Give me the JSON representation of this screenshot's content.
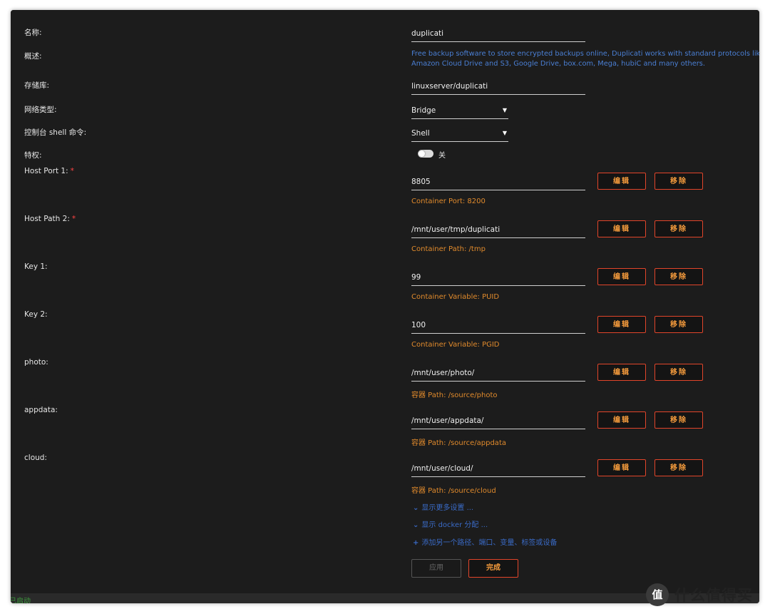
{
  "form": {
    "name_label": "名称:",
    "name_value": "duplicati",
    "overview_label": "概述:",
    "overview_line1": "Free backup software to store encrypted backups online, Duplicati works with standard protocols like FTP, SSH, WebDAV as well as popular services like Microsoft OneDrive,",
    "overview_line2": "Amazon Cloud Drive and S3, Google Drive, box.com, Mega, hubiC and many others.",
    "repo_label": "存储库:",
    "repo_value": "linuxserver/duplicati",
    "network_label": "网络类型:",
    "network_value": "Bridge",
    "shell_label": "控制台 shell 命令:",
    "shell_value": "Shell",
    "privileged_label": "特权:",
    "privileged_state": "关"
  },
  "entries": [
    {
      "label": "Host Port 1:",
      "required": "*",
      "value": "8805",
      "hint": "Container Port: 8200"
    },
    {
      "label": "Host Path 2:",
      "required": "*",
      "value": "/mnt/user/tmp/duplicati",
      "hint": "Container Path: /tmp"
    },
    {
      "label": "Key 1:",
      "required": "",
      "value": "99",
      "hint": "Container Variable: PUID"
    },
    {
      "label": "Key 2:",
      "required": "",
      "value": "100",
      "hint": "Container Variable: PGID"
    },
    {
      "label": "photo:",
      "required": "",
      "value": "/mnt/user/photo/",
      "hint": "容器 Path: /source/photo"
    },
    {
      "label": "appdata:",
      "required": "",
      "value": "/mnt/user/appdata/",
      "hint": "容器 Path: /source/appdata"
    },
    {
      "label": "cloud:",
      "required": "",
      "value": "/mnt/user/cloud/",
      "hint": "容器 Path: /source/cloud"
    }
  ],
  "buttons": {
    "edit": "编辑",
    "remove": "移除",
    "apply": "应用",
    "done": "完成"
  },
  "links": {
    "more_settings": "显示更多设置 ...",
    "docker_alloc": "显示 docker 分配 ...",
    "add_another": "添加另一个路径、端口、变量、标签或设备"
  },
  "icons": {
    "chevron": "chevron-down-icon",
    "plus": "plus-icon",
    "caret": "caret-down-icon"
  },
  "status": "已启动",
  "watermark": {
    "logo": "值",
    "text": "什么值得买"
  },
  "colors": {
    "accent": "#e2452a",
    "button_text": "#f39a3c",
    "hint": "#e08a2c",
    "link": "#3a6bc8",
    "background": "#1c1c1c"
  }
}
